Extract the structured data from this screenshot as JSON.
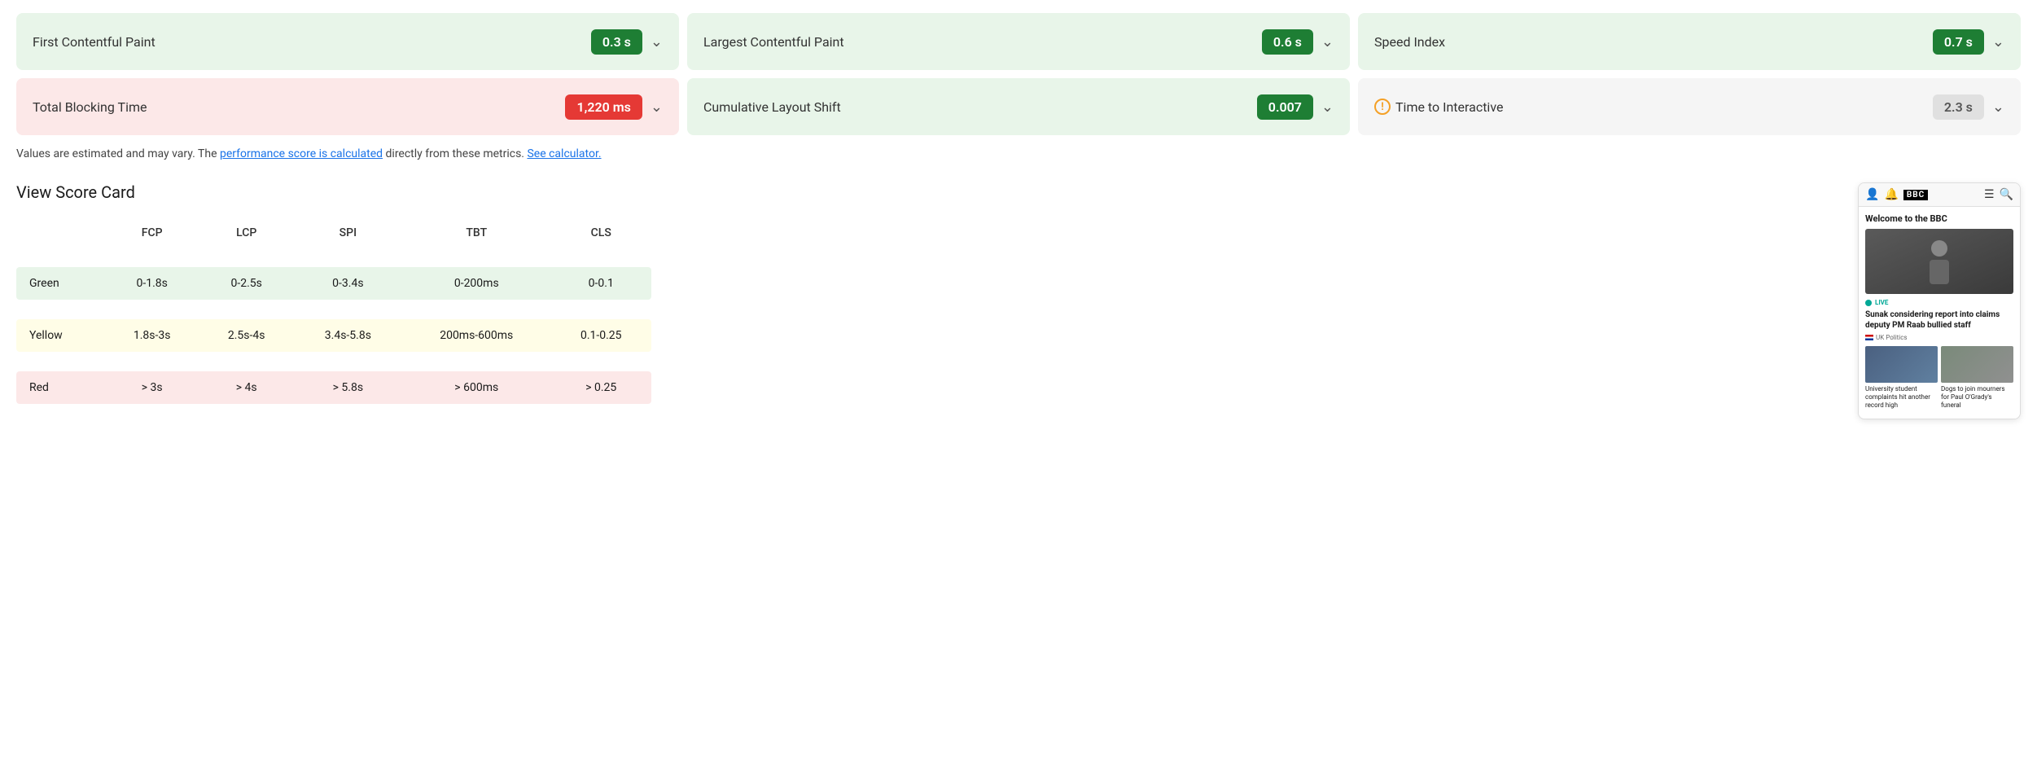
{
  "metrics_row1": [
    {
      "id": "fcp",
      "label": "First Contentful Paint",
      "value": "0.3 s",
      "badge_type": "green",
      "card_bg": "green-bg",
      "has_info": false
    },
    {
      "id": "lcp",
      "label": "Largest Contentful Paint",
      "value": "0.6 s",
      "badge_type": "green",
      "card_bg": "green-bg",
      "has_info": false
    },
    {
      "id": "si",
      "label": "Speed Index",
      "value": "0.7 s",
      "badge_type": "green",
      "card_bg": "green-bg",
      "has_info": false
    }
  ],
  "metrics_row2": [
    {
      "id": "tbt",
      "label": "Total Blocking Time",
      "value": "1,220 ms",
      "badge_type": "red",
      "card_bg": "red-bg",
      "has_info": false
    },
    {
      "id": "cls",
      "label": "Cumulative Layout Shift",
      "value": "0.007",
      "badge_type": "green",
      "card_bg": "green-bg",
      "has_info": false
    },
    {
      "id": "tti",
      "label": "Time to Interactive",
      "value": "2.3 s",
      "badge_type": "gray",
      "card_bg": "gray-bg",
      "has_info": true
    }
  ],
  "notes": {
    "prefix": "Values are estimated and may vary. The ",
    "link1": "performance score is calculated",
    "middle": " directly from these metrics. ",
    "link2": "See calculator."
  },
  "scorecard": {
    "title": "View Score Card",
    "headers": [
      "",
      "FCP",
      "LCP",
      "SPI",
      "TBT",
      "CLS"
    ],
    "rows": [
      {
        "label": "Green",
        "bg": "row-green",
        "fcp": "0-1.8s",
        "lcp": "0-2.5s",
        "spi": "0-3.4s",
        "tbt": "0-200ms",
        "cls": "0-0.1"
      },
      {
        "label": "Yellow",
        "bg": "row-yellow",
        "fcp": "1.8s-3s",
        "lcp": "2.5s-4s",
        "spi": "3.4s-5.8s",
        "tbt": "200ms-600ms",
        "cls": "0.1-0.25"
      },
      {
        "label": "Red",
        "bg": "row-red",
        "fcp": "> 3s",
        "lcp": "> 4s",
        "spi": "> 5.8s",
        "tbt": "> 600ms",
        "cls": "> 0.25"
      }
    ]
  },
  "browser_preview": {
    "welcome": "Welcome to the BBC",
    "live_label": "LIVE",
    "headline": "Sunak considering report into claims deputy PM Raab bullied staff",
    "category": "UK Politics",
    "thumb1_caption": "University student complaints hit another record high",
    "thumb2_caption": "Dogs to join mourners for Paul O'Grady's funeral"
  }
}
